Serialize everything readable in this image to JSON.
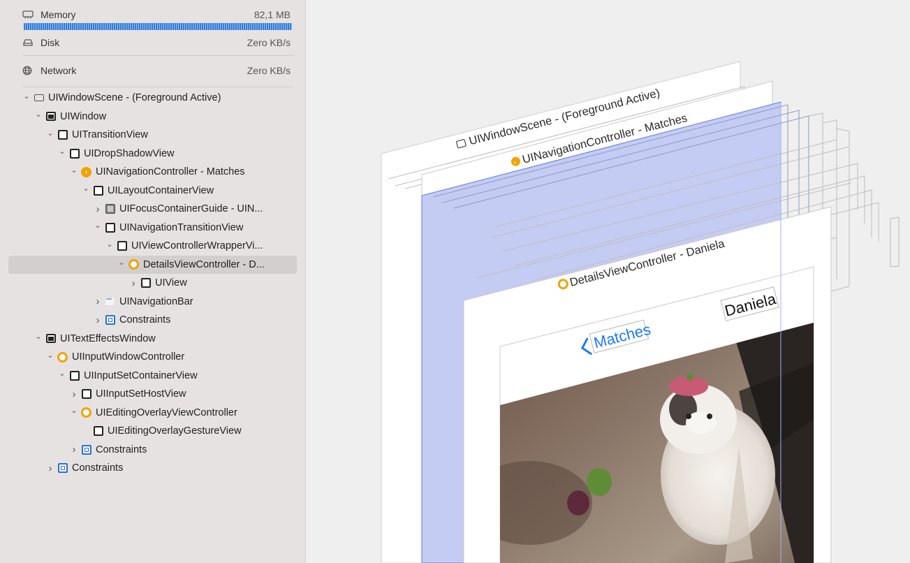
{
  "gauges": {
    "memory": {
      "label": "Memory",
      "value": "82,1 MB",
      "fill_fraction": 1.0
    },
    "disk": {
      "label": "Disk",
      "value": "Zero KB/s"
    },
    "network": {
      "label": "Network",
      "value": "Zero KB/s"
    }
  },
  "tree": [
    {
      "label": "UIWindowScene - (Foreground Active)",
      "icon": "scene-icon",
      "depth": 0,
      "disclosure": "open"
    },
    {
      "label": "UIWindow",
      "icon": "window-icon",
      "depth": 1,
      "disclosure": "open"
    },
    {
      "label": "UITransitionView",
      "icon": "view-icon",
      "depth": 2,
      "disclosure": "open"
    },
    {
      "label": "UIDropShadowView",
      "icon": "view-icon",
      "depth": 3,
      "disclosure": "open"
    },
    {
      "label": "UINavigationController - Matches",
      "icon": "navigation-controller-icon",
      "depth": 4,
      "disclosure": "open"
    },
    {
      "label": "UILayoutContainerView",
      "icon": "view-icon",
      "depth": 5,
      "disclosure": "open"
    },
    {
      "label": "UIFocusContainerGuide - UIN...",
      "icon": "focus-guide-icon",
      "depth": 6,
      "disclosure": "closed"
    },
    {
      "label": "UINavigationTransitionView",
      "icon": "view-icon",
      "depth": 6,
      "disclosure": "open"
    },
    {
      "label": "UIViewControllerWrapperVi...",
      "icon": "view-icon",
      "depth": 7,
      "disclosure": "open"
    },
    {
      "label": "DetailsViewController - D...",
      "icon": "view-controller-icon",
      "depth": 8,
      "disclosure": "open",
      "selected": true
    },
    {
      "label": "UIView",
      "icon": "view-icon",
      "depth": 9,
      "disclosure": "closed"
    },
    {
      "label": "UINavigationBar",
      "icon": "navigation-bar-icon",
      "depth": 6,
      "disclosure": "closed"
    },
    {
      "label": "Constraints",
      "icon": "constraints-icon",
      "depth": 6,
      "disclosure": "closed"
    },
    {
      "label": "UITextEffectsWindow",
      "icon": "window-icon",
      "depth": 1,
      "disclosure": "open"
    },
    {
      "label": "UIInputWindowController",
      "icon": "view-controller-icon",
      "depth": 2,
      "disclosure": "open"
    },
    {
      "label": "UIInputSetContainerView",
      "icon": "view-icon",
      "depth": 3,
      "disclosure": "open"
    },
    {
      "label": "UIInputSetHostView",
      "icon": "view-icon",
      "depth": 4,
      "disclosure": "closed"
    },
    {
      "label": "UIEditingOverlayViewController",
      "icon": "view-controller-icon",
      "depth": 4,
      "disclosure": "open"
    },
    {
      "label": "UIEditingOverlayGestureView",
      "icon": "view-icon",
      "depth": 5,
      "disclosure": "none"
    },
    {
      "label": "Constraints",
      "icon": "constraints-icon",
      "depth": 4,
      "disclosure": "closed"
    },
    {
      "label": "Constraints",
      "icon": "constraints-icon",
      "depth": 2,
      "disclosure": "closed"
    }
  ],
  "canvas": {
    "scene_label": "UIWindowScene - (Foreground Active)",
    "nav_controller_label": "UINavigationController - Matches",
    "details_label": "DetailsViewController - Daniela",
    "back_button_label": "Matches",
    "nav_title": "Daniela",
    "selection_color": "#c4ccf3",
    "accent_color": "#1a7cf0",
    "vc_color": "#f0a300"
  }
}
